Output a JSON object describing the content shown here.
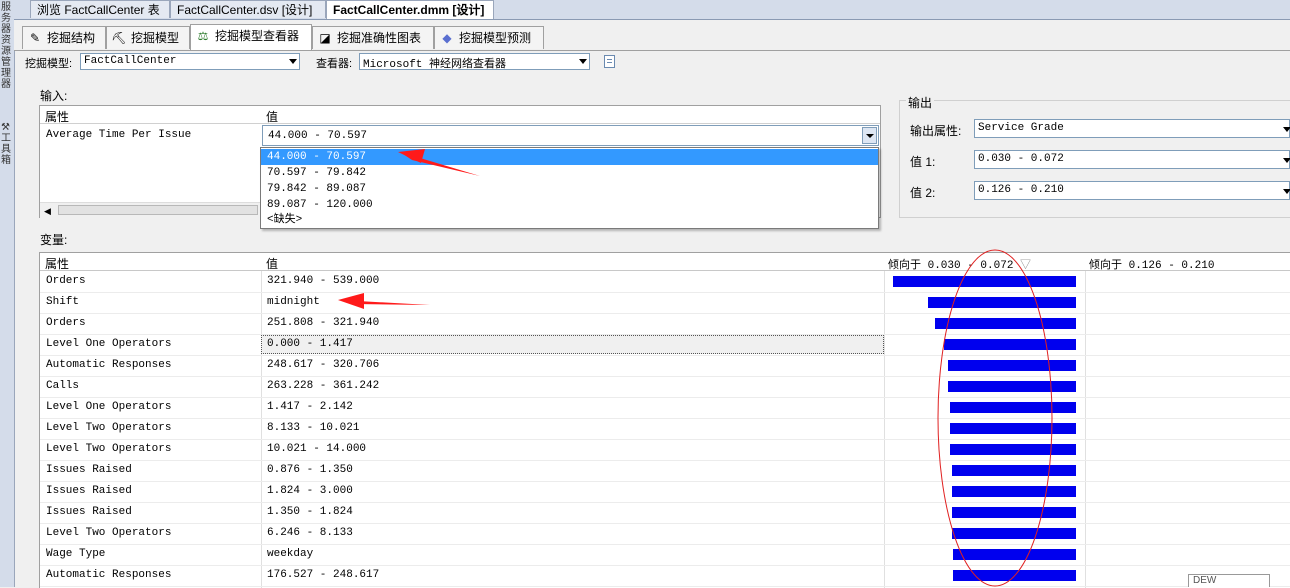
{
  "left_strip": {
    "text_a": "服务器资源管理器",
    "text_b": "工具箱"
  },
  "doc_tabs": [
    {
      "label": "浏览 FactCallCenter 表"
    },
    {
      "label": "FactCallCenter.dsv [设计]"
    },
    {
      "label": "FactCallCenter.dmm [设计]"
    }
  ],
  "designer_tabs": [
    {
      "label": "挖掘结构",
      "icon": "mining-structure-icon",
      "glyph": "✎"
    },
    {
      "label": "挖掘模型",
      "icon": "mining-model-icon",
      "glyph": "⛏"
    },
    {
      "label": "挖掘模型查看器",
      "icon": "model-viewer-icon",
      "glyph": "⚖"
    },
    {
      "label": "挖掘准确性图表",
      "icon": "accuracy-chart-icon",
      "glyph": "◪"
    },
    {
      "label": "挖掘模型预测",
      "icon": "prediction-icon",
      "glyph": "◆"
    }
  ],
  "toolbar": {
    "model_label": "挖掘模型:",
    "model_value": "FactCallCenter",
    "viewer_label": "查看器:",
    "viewer_value": "Microsoft 神经网络查看器"
  },
  "input": {
    "section_label": "输入:",
    "col_attr": "属性",
    "col_value": "值",
    "row_attr": "Average Time Per Issue",
    "row_value": "44.000 - 70.597",
    "dropdown_options": [
      "44.000 - 70.597",
      "70.597 - 79.842",
      "79.842 - 89.087",
      "89.087 - 120.000",
      "<缺失>"
    ],
    "dropdown_selected_index": 0
  },
  "output": {
    "section_label": "输出",
    "attr_label": "输出属性:",
    "attr_value": "Service Grade",
    "value1_label": "值 1:",
    "value1": "0.030 - 0.072",
    "value2_label": "值 2:",
    "value2": "0.126 - 0.210"
  },
  "variables": {
    "section_label": "变量:",
    "col_attr": "属性",
    "col_value": "值",
    "col_favors1": "倾向于 0.030 - 0.072",
    "col_favors2": "倾向于 0.126 - 0.210",
    "bar_color": "#0000ee",
    "sort_indicator": "▽",
    "rows": [
      {
        "attr": "Orders",
        "value": "321.940 - 539.000",
        "favors1_score": 1.0
      },
      {
        "attr": "Shift",
        "value": "midnight",
        "favors1_score": 0.81
      },
      {
        "attr": "Orders",
        "value": "251.808 - 321.940",
        "favors1_score": 0.77
      },
      {
        "attr": "Level One Operators",
        "value": "0.000 - 1.417",
        "favors1_score": 0.72
      },
      {
        "attr": "Automatic Responses",
        "value": "248.617 - 320.706",
        "favors1_score": 0.7
      },
      {
        "attr": "Calls",
        "value": "263.228 - 361.242",
        "favors1_score": 0.7
      },
      {
        "attr": "Level One Operators",
        "value": "1.417 - 2.142",
        "favors1_score": 0.69
      },
      {
        "attr": "Level Two Operators",
        "value": "8.133 - 10.021",
        "favors1_score": 0.69
      },
      {
        "attr": "Level Two Operators",
        "value": "10.021 - 14.000",
        "favors1_score": 0.69
      },
      {
        "attr": "Issues Raised",
        "value": "0.876 - 1.350",
        "favors1_score": 0.68
      },
      {
        "attr": "Issues Raised",
        "value": "1.824 - 3.000",
        "favors1_score": 0.68
      },
      {
        "attr": "Issues Raised",
        "value": "1.350 - 1.824",
        "favors1_score": 0.68
      },
      {
        "attr": "Level Two Operators",
        "value": "6.246 - 8.133",
        "favors1_score": 0.68
      },
      {
        "attr": "Wage Type",
        "value": "weekday",
        "favors1_score": 0.67
      },
      {
        "attr": "Automatic Responses",
        "value": "176.527 - 248.617",
        "favors1_score": 0.67
      }
    ]
  },
  "status_corner": "DEW"
}
